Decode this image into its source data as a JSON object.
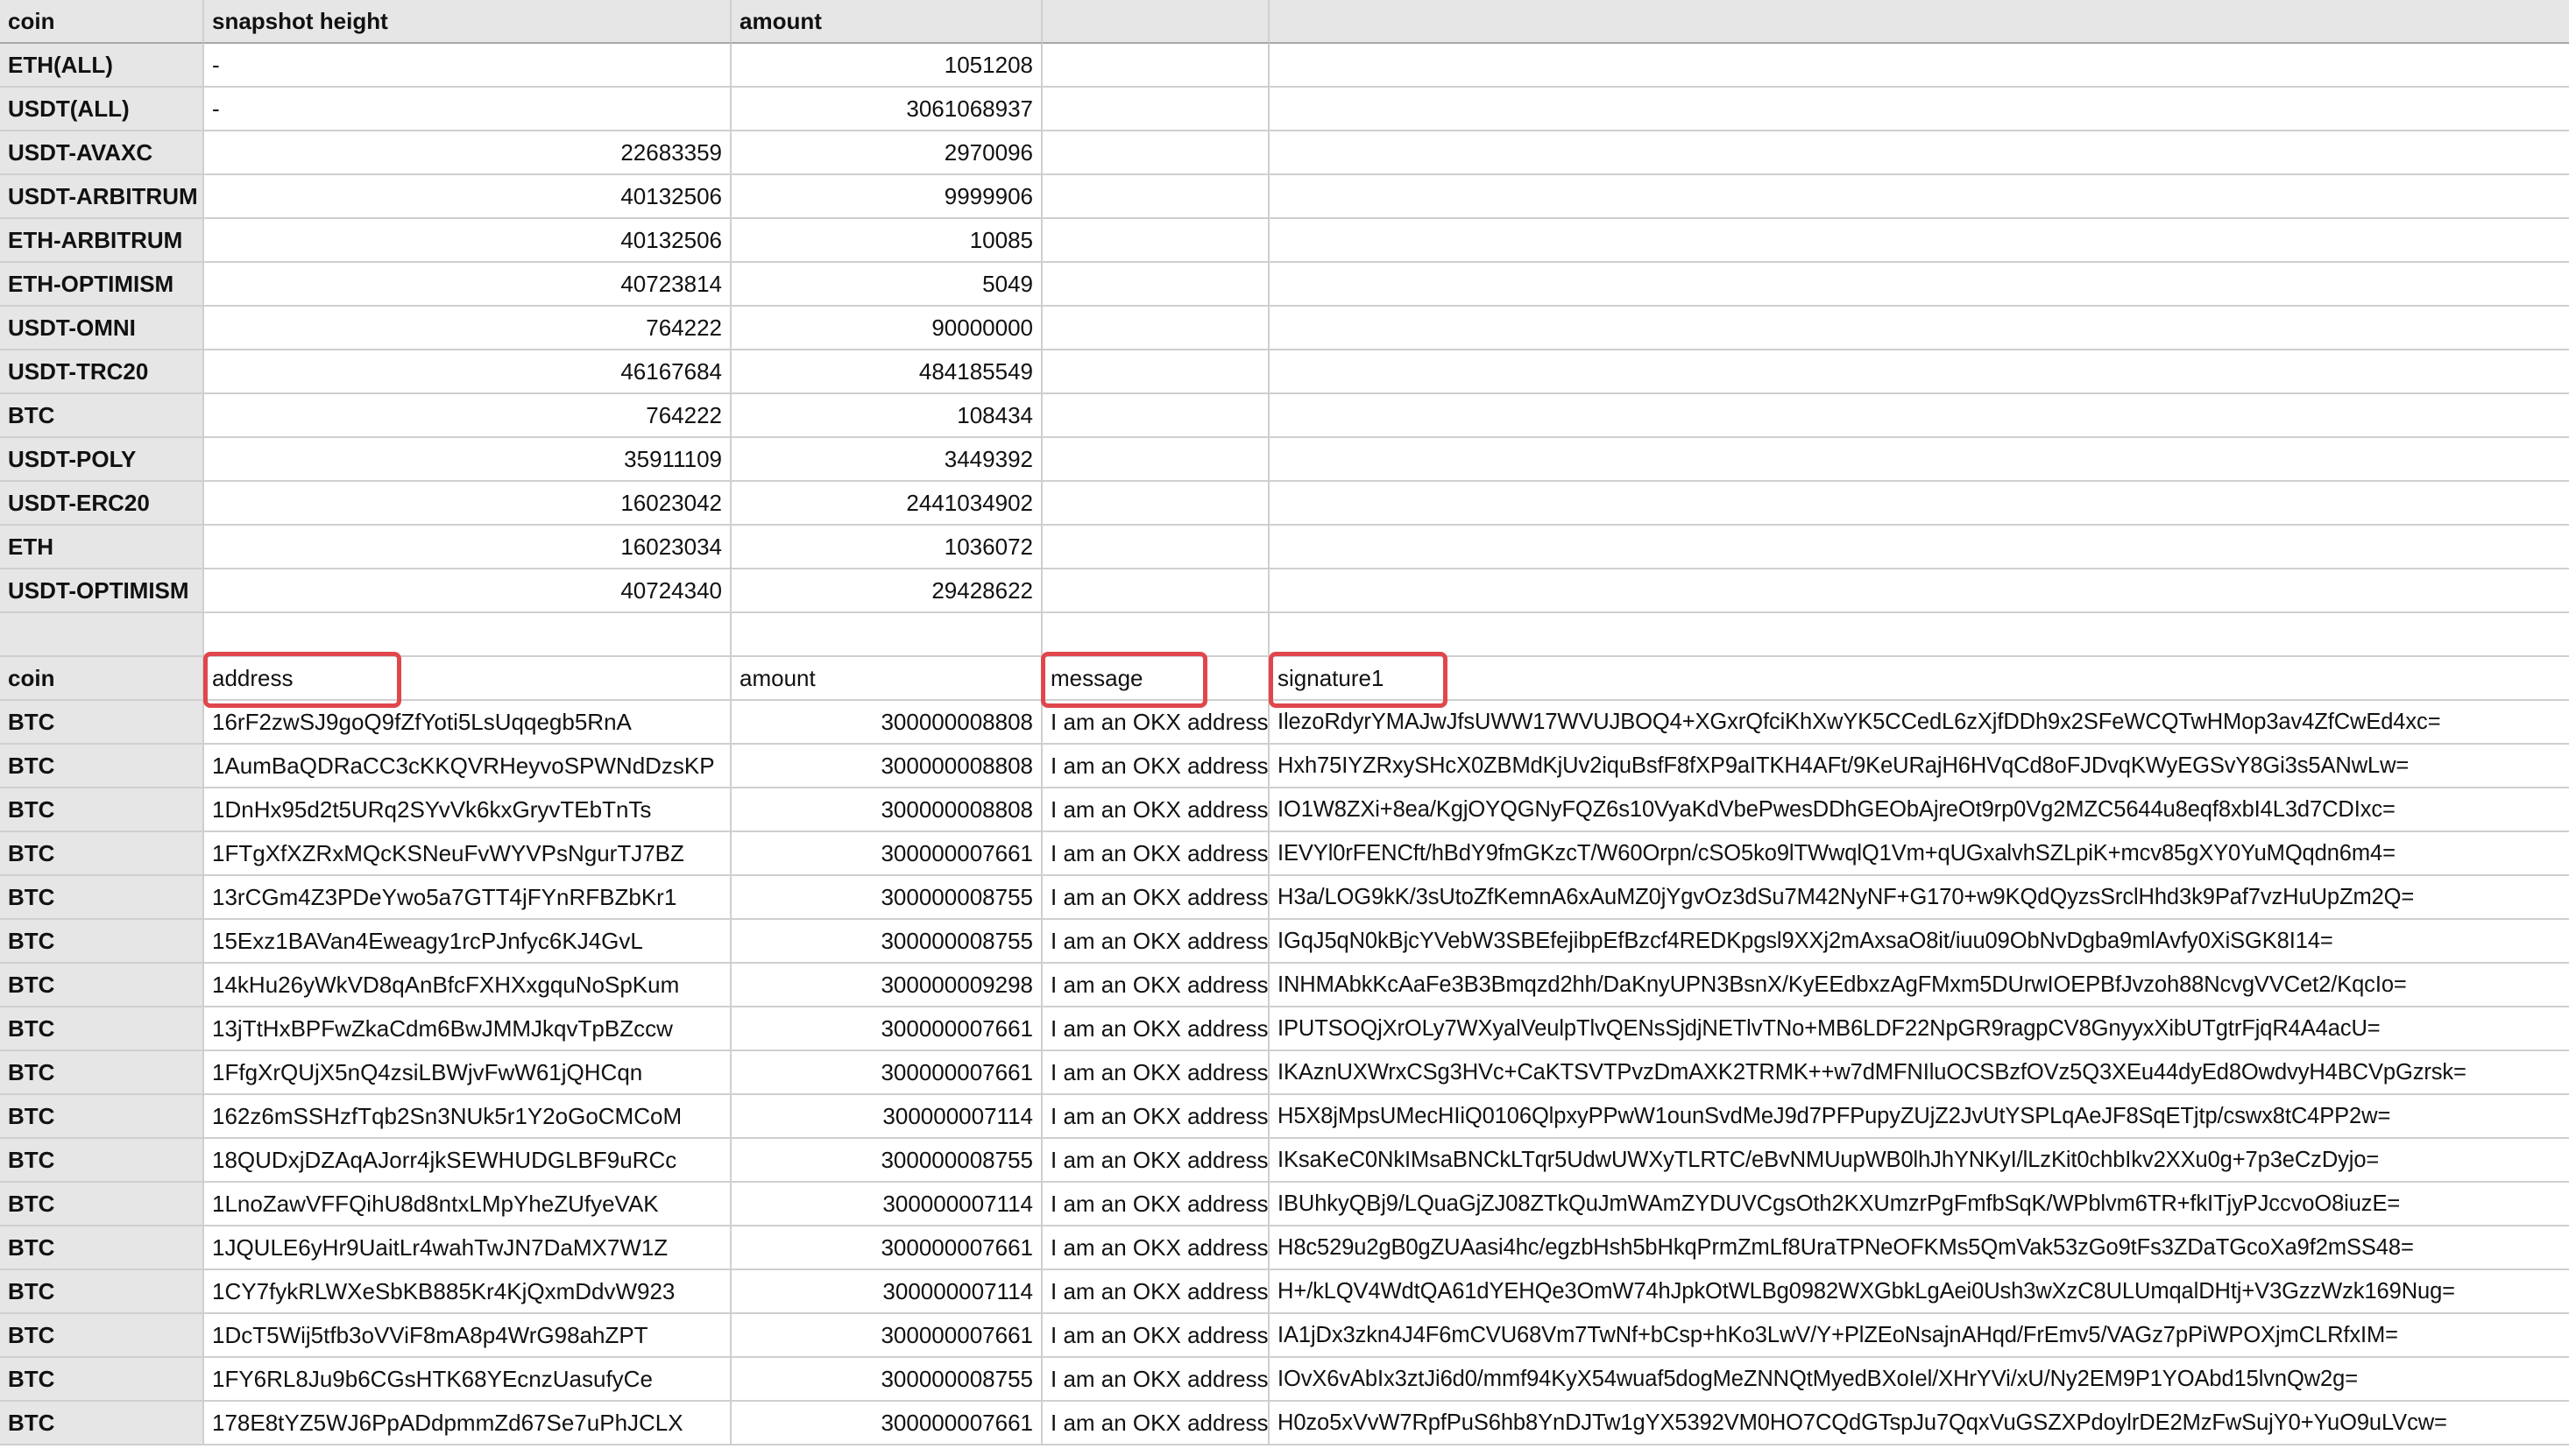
{
  "top_table": {
    "headers": [
      "coin",
      "snapshot height",
      "amount",
      "",
      ""
    ],
    "rows": [
      {
        "coin": "ETH(ALL)",
        "height": "-",
        "amount": "1051208"
      },
      {
        "coin": "USDT(ALL)",
        "height": "-",
        "amount": "3061068937"
      },
      {
        "coin": "USDT-AVAXC",
        "height": "22683359",
        "amount": "2970096"
      },
      {
        "coin": "USDT-ARBITRUM",
        "height": "40132506",
        "amount": "9999906"
      },
      {
        "coin": "ETH-ARBITRUM",
        "height": "40132506",
        "amount": "10085"
      },
      {
        "coin": "ETH-OPTIMISM",
        "height": "40723814",
        "amount": "5049"
      },
      {
        "coin": "USDT-OMNI",
        "height": "764222",
        "amount": "90000000"
      },
      {
        "coin": "USDT-TRC20",
        "height": "46167684",
        "amount": "484185549"
      },
      {
        "coin": "BTC",
        "height": "764222",
        "amount": "108434"
      },
      {
        "coin": "USDT-POLY",
        "height": "35911109",
        "amount": "3449392"
      },
      {
        "coin": "USDT-ERC20",
        "height": "16023042",
        "amount": "2441034902"
      },
      {
        "coin": "ETH",
        "height": "16023034",
        "amount": "1036072"
      },
      {
        "coin": "USDT-OPTIMISM",
        "height": "40724340",
        "amount": "29428622"
      }
    ]
  },
  "bottom_table": {
    "headers": [
      "coin",
      "address",
      "amount",
      "message",
      "signature1"
    ],
    "rows": [
      {
        "coin": "BTC",
        "address": "16rF2zwSJ9goQ9fZfYoti5LsUqqegb5RnA",
        "amount": "300000008808",
        "message": "I am an OKX address",
        "signature": "IlezoRdyrYMAJwJfsUWW17WVUJBOQ4+XGxrQfciKhXwYK5CCedL6zXjfDDh9x2SFeWCQTwHMop3av4ZfCwEd4xc="
      },
      {
        "coin": "BTC",
        "address": "1AumBaQDRaCC3cKKQVRHeyvoSPWNdDzsKP",
        "amount": "300000008808",
        "message": "I am an OKX address",
        "signature": "Hxh75IYZRxySHcX0ZBMdKjUv2iquBsfF8fXP9aITKH4AFt/9KeURajH6HVqCd8oFJDvqKWyEGSvY8Gi3s5ANwLw="
      },
      {
        "coin": "BTC",
        "address": "1DnHx95d2t5URq2SYvVk6kxGryvTEbTnTs",
        "amount": "300000008808",
        "message": "I am an OKX address",
        "signature": "IO1W8ZXi+8ea/KgjOYQGNyFQZ6s10VyaKdVbePwesDDhGEObAjreOt9rp0Vg2MZC5644u8eqf8xbI4L3d7CDIxc="
      },
      {
        "coin": "BTC",
        "address": "1FTgXfXZRxMQcKSNeuFvWYVPsNgurTJ7BZ",
        "amount": "300000007661",
        "message": "I am an OKX address",
        "signature": "IEVYl0rFENCft/hBdY9fmGKzcT/W60Orpn/cSO5ko9lTWwqlQ1Vm+qUGxalvhSZLpiK+mcv85gXY0YuMQqdn6m4="
      },
      {
        "coin": "BTC",
        "address": "13rCGm4Z3PDeYwo5a7GTT4jFYnRFBZbKr1",
        "amount": "300000008755",
        "message": "I am an OKX address",
        "signature": "H3a/LOG9kK/3sUtoZfKemnA6xAuMZ0jYgvOz3dSu7M42NyNF+G170+w9KQdQyzsSrclHhd3k9Paf7vzHuUpZm2Q="
      },
      {
        "coin": "BTC",
        "address": "15Exz1BAVan4Eweagy1rcPJnfyc6KJ4GvL",
        "amount": "300000008755",
        "message": "I am an OKX address",
        "signature": "IGqJ5qN0kBjcYVebW3SBEfejibpEfBzcf4REDKpgsl9XXj2mAxsaO8it/iuu09ObNvDgba9mlAvfy0XiSGK8I14="
      },
      {
        "coin": "BTC",
        "address": "14kHu26yWkVD8qAnBfcFXHXxgquNoSpKum",
        "amount": "300000009298",
        "message": "I am an OKX address",
        "signature": "INHMAbkKcAaFe3B3Bmqzd2hh/DaKnyUPN3BsnX/KyEEdbxzAgFMxm5DUrwIOEPBfJvzoh88NcvgVVCet2/KqcIo="
      },
      {
        "coin": "BTC",
        "address": "13jTtHxBPFwZkaCdm6BwJMMJkqvTpBZccw",
        "amount": "300000007661",
        "message": "I am an OKX address",
        "signature": "IPUTSOQjXrOLy7WXyalVeulpTlvQENsSjdjNETlvTNo+MB6LDF22NpGR9ragpCV8GnyyxXibUTgtrFjqR4A4acU="
      },
      {
        "coin": "BTC",
        "address": "1FfgXrQUjX5nQ4zsiLBWjvFwW61jQHCqn",
        "amount": "300000007661",
        "message": "I am an OKX address",
        "signature": "IKAznUXWrxCSg3HVc+CaKTSVTPvzDmAXK2TRMK++w7dMFNIluOCSBzfOVz5Q3XEu44dyEd8OwdvyH4BCVpGzrsk="
      },
      {
        "coin": "BTC",
        "address": "162z6mSSHzfTqb2Sn3NUk5r1Y2oGoCMCoM",
        "amount": "300000007114",
        "message": "I am an OKX address",
        "signature": "H5X8jMpsUMecHIiQ0106QlpxyPPwW1ounSvdMeJ9d7PFPupyZUjZ2JvUtYSPLqAeJF8SqETjtp/cswx8tC4PP2w="
      },
      {
        "coin": "BTC",
        "address": "18QUDxjDZAqAJorr4jkSEWHUDGLBF9uRCc",
        "amount": "300000008755",
        "message": "I am an OKX address",
        "signature": "IKsaKeC0NkIMsaBNCkLTqr5UdwUWXyTLRTC/eBvNMUupWB0lhJhYNKyI/lLzKit0chbIkv2XXu0g+7p3eCzDyjo="
      },
      {
        "coin": "BTC",
        "address": "1LnoZawVFFQihU8d8ntxLMpYheZUfyeVAK",
        "amount": "300000007114",
        "message": "I am an OKX address",
        "signature": "IBUhkyQBj9/LQuaGjZJ08ZTkQuJmWAmZYDUVCgsOth2KXUmzrPgFmfbSqK/WPblvm6TR+fkITjyPJccvoO8iuzE="
      },
      {
        "coin": "BTC",
        "address": "1JQULE6yHr9UaitLr4wahTwJN7DaMX7W1Z",
        "amount": "300000007661",
        "message": "I am an OKX address",
        "signature": "H8c529u2gB0gZUAasi4hc/egzbHsh5bHkqPrmZmLf8UraTPNeOFKMs5QmVak53zGo9tFs3ZDaTGcoXa9f2mSS48="
      },
      {
        "coin": "BTC",
        "address": "1CY7fykRLWXeSbKB885Kr4KjQxmDdvW923",
        "amount": "300000007114",
        "message": "I am an OKX address",
        "signature": "H+/kLQV4WdtQA61dYEHQe3OmW74hJpkOtWLBg0982WXGbkLgAei0Ush3wXzC8ULUmqalDHtj+V3GzzWzk169Nug="
      },
      {
        "coin": "BTC",
        "address": "1DcT5Wij5tfb3oVViF8mA8p4WrG98ahZPT",
        "amount": "300000007661",
        "message": "I am an OKX address",
        "signature": "IA1jDx3zkn4J4F6mCVU68Vm7TwNf+bCsp+hKo3LwV/Y+PlZEoNsajnAHqd/FrEmv5/VAGz7pPiWPOXjmCLRfxIM="
      },
      {
        "coin": "BTC",
        "address": "1FY6RL8Ju9b6CGsHTK68YEcnzUasufyCe",
        "amount": "300000008755",
        "message": "I am an OKX address",
        "signature": "IOvX6vAbIx3ztJi6d0/mmf94KyX54wuaf5dogMeZNNQtMyedBXoIel/XHrYVi/xU/Ny2EM9P1YOAbd15lvnQw2g="
      },
      {
        "coin": "BTC",
        "address": "178E8tYZ5WJ6PpADdpmmZd67Se7uPhJCLX",
        "amount": "300000007661",
        "message": "I am an OKX address",
        "signature": "H0zo5xVvW7RpfPuS6hb8YnDJTw1gYX5392VM0HO7CQdGTspJu7QqxVuGSZXPdoylrDE2MzFwSujY0+YuO9uLVcw="
      }
    ]
  },
  "highlight_color": "#e0474c",
  "header_bg_color": "#e6e6e6"
}
